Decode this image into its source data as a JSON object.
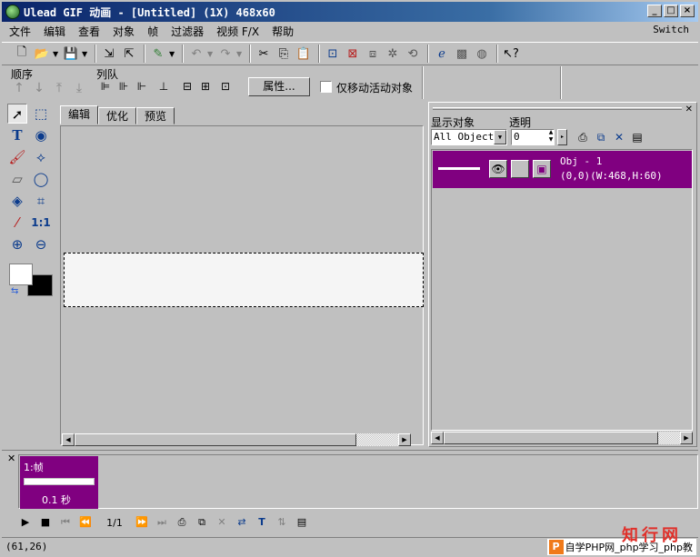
{
  "window": {
    "title": "Ulead GIF 动画 - [Untitled] (1X) 468x60",
    "buttons": [
      "_",
      "□",
      "×"
    ]
  },
  "menu": {
    "items": [
      "文件",
      "编辑",
      "查看",
      "对象",
      "帧",
      "过滤器",
      "视频 F/X",
      "帮助"
    ],
    "switch_label": "Switch"
  },
  "toolbar": {
    "icons": [
      "new-icon",
      "open-icon",
      "save-icon",
      "import-icon",
      "export-icon",
      "wizard-icon",
      "undo-icon",
      "redo-icon",
      "cut-icon",
      "copy-icon",
      "paste-icon",
      "crop-icon",
      "resize-icon",
      "tween-icon",
      "optimize-icon",
      "web-icon",
      "preview-icon",
      "help-icon"
    ]
  },
  "toolbar2": {
    "order_label": "顺序",
    "queue_label": "列队",
    "properties_button": "属性...",
    "move_active_only_label": "仅移动活动对象",
    "move_active_only_checked": false
  },
  "tools": [
    "pointer-tool",
    "marquee-tool",
    "text-tool",
    "transform-tool",
    "brush-tool",
    "lasso-tool",
    "eraser-tool",
    "ellipse-select-tool",
    "fill-tool",
    "crop-tool",
    "eyedropper-tool",
    "actual-size-tool",
    "zoom-in-tool",
    "zoom-out-tool"
  ],
  "colors": {
    "foreground": "#ffffff",
    "background": "#000000",
    "selection": "#800080"
  },
  "doc_tabs": [
    "编辑",
    "优化",
    "预览"
  ],
  "object_manager": {
    "show_label": "显示对象",
    "opacity_label": "透明",
    "show_value": "All Objects",
    "opacity_value": "0",
    "objects": [
      {
        "name": "Obj - 1",
        "info": "(0,0)(W:468,H:60)"
      }
    ]
  },
  "frames": {
    "items": [
      {
        "title": "1:帧",
        "delay": "0.1 秒"
      }
    ],
    "counter": "1/1"
  },
  "status": {
    "coords": "(61,26)",
    "watermark_logo": "P",
    "watermark_text": "自学PHP网_php学习_php教",
    "watermark_brand": "知行网"
  }
}
